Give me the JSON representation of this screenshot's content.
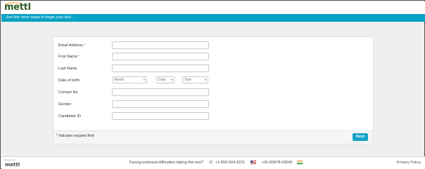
{
  "header": {
    "logo_text": "mettl",
    "banner_text": "Just few more steps to begin your test...",
    "colors": {
      "banner": "#08a2c4",
      "logo": "#2e5c29"
    }
  },
  "form": {
    "fields": [
      {
        "label": "Email Address",
        "required": "*",
        "type": "text",
        "value": ""
      },
      {
        "label": "First Name",
        "required": "*",
        "type": "text",
        "value": ""
      },
      {
        "label": "Last Name",
        "required": "",
        "type": "text",
        "value": ""
      },
      {
        "label": "Date of birth",
        "required": "",
        "type": "date",
        "value": ""
      },
      {
        "label": "Contact No",
        "required": "",
        "type": "text",
        "value": ""
      },
      {
        "label": "Gender",
        "required": "",
        "type": "text",
        "value": ""
      },
      {
        "label": "Candidate ID",
        "required": "",
        "type": "text",
        "value": ""
      }
    ],
    "dob": {
      "month_placeholder": "Month",
      "date_placeholder": "Date",
      "year_placeholder": "Year",
      "caret_icon": "caret-down-icon"
    },
    "required_note": "* Indicates required field",
    "next_label": "Next",
    "colors": {
      "next_button": "#17a2c7",
      "required_star": "#d9534f"
    }
  },
  "footer": {
    "powered_by": "Powered by",
    "powered_logo": "mettl",
    "help_text": "Facing technical difficulties taking this test?",
    "phone_icon": "phone-icon",
    "phone_us": "+1-650-924-9221",
    "phone_in": "+91-82878-03040",
    "privacy_label": "Privacy Policy"
  }
}
